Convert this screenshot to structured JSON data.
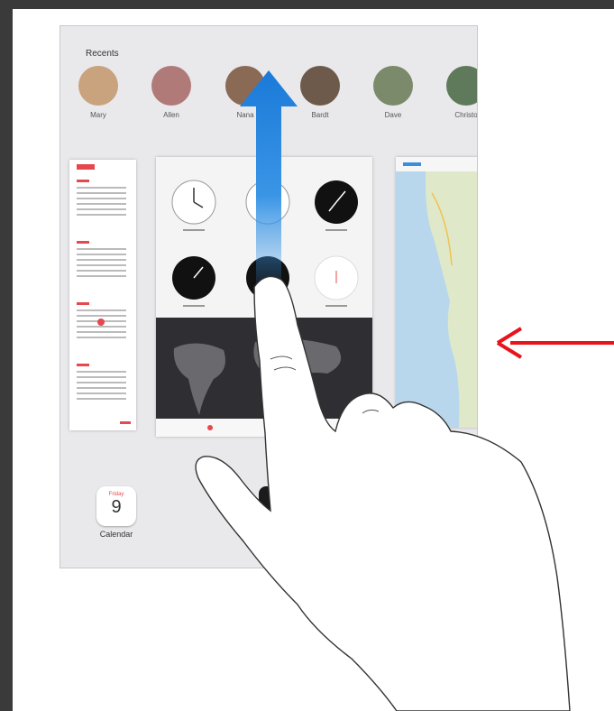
{
  "recents": {
    "title": "Recents",
    "contacts": [
      {
        "name": "Mary",
        "avatar_color": "#c9a27e"
      },
      {
        "name": "Allen",
        "avatar_color": "#b07a78"
      },
      {
        "name": "Nana",
        "avatar_color": "#8a6a55"
      },
      {
        "name": "Bardt",
        "avatar_color": "#6d5a4a"
      },
      {
        "name": "Dave",
        "avatar_color": "#7a8a6a"
      },
      {
        "name": "Christo",
        "avatar_color": "#5f7a5a"
      }
    ]
  },
  "dock": {
    "calendar_day": "Friday",
    "calendar_date": "9",
    "calendar_label": "Calendar"
  },
  "colors": {
    "swipe_arrow": "#1a7ad8",
    "pointer_arrow": "#e8141c",
    "calendar_red": "#e5484d",
    "map_water": "#b9d7ec",
    "map_land": "#dfe9c9"
  },
  "gesture": {
    "direction": "swipe-up"
  }
}
